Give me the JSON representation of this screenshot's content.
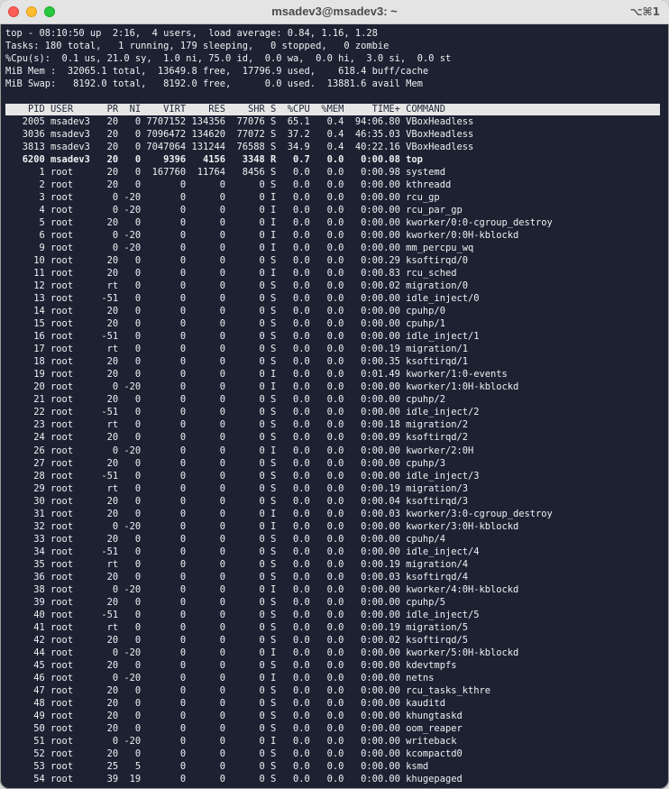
{
  "window": {
    "title": "msadev3@msadev3: ~",
    "shortcut": "⌥⌘1"
  },
  "summary": [
    "top - 08:10:50 up  2:16,  4 users,  load average: 0.84, 1.16, 1.28",
    "Tasks: 180 total,   1 running, 179 sleeping,   0 stopped,   0 zombie",
    "%Cpu(s):  0.1 us, 21.0 sy,  1.0 ni, 75.0 id,  0.0 wa,  0.0 hi,  3.0 si,  0.0 st",
    "MiB Mem :  32065.1 total,  13649.8 free,  17796.9 used,    618.4 buff/cache",
    "MiB Swap:   8192.0 total,   8192.0 free,      0.0 used.  13881.6 avail Mem"
  ],
  "columns": [
    "PID",
    "USER",
    "PR",
    "NI",
    "VIRT",
    "RES",
    "SHR",
    "S",
    "%CPU",
    "%MEM",
    "TIME+",
    "COMMAND"
  ],
  "processes": [
    {
      "pid": "2005",
      "user": "msadev3",
      "pr": "20",
      "ni": "0",
      "virt": "7707152",
      "res": "134356",
      "shr": "77076",
      "s": "S",
      "cpu": "65.1",
      "mem": "0.4",
      "time": "94:06.80",
      "cmd": "VBoxHeadless"
    },
    {
      "pid": "3036",
      "user": "msadev3",
      "pr": "20",
      "ni": "0",
      "virt": "7096472",
      "res": "134620",
      "shr": "77072",
      "s": "S",
      "cpu": "37.2",
      "mem": "0.4",
      "time": "46:35.03",
      "cmd": "VBoxHeadless"
    },
    {
      "pid": "3813",
      "user": "msadev3",
      "pr": "20",
      "ni": "0",
      "virt": "7047064",
      "res": "131244",
      "shr": "76588",
      "s": "S",
      "cpu": "34.9",
      "mem": "0.4",
      "time": "40:22.16",
      "cmd": "VBoxHeadless"
    },
    {
      "pid": "6200",
      "user": "msadev3",
      "pr": "20",
      "ni": "0",
      "virt": "9396",
      "res": "4156",
      "shr": "3348",
      "s": "R",
      "cpu": "0.7",
      "mem": "0.0",
      "time": "0:00.08",
      "cmd": "top",
      "bold": true
    },
    {
      "pid": "1",
      "user": "root",
      "pr": "20",
      "ni": "0",
      "virt": "167760",
      "res": "11764",
      "shr": "8456",
      "s": "S",
      "cpu": "0.0",
      "mem": "0.0",
      "time": "0:00.98",
      "cmd": "systemd"
    },
    {
      "pid": "2",
      "user": "root",
      "pr": "20",
      "ni": "0",
      "virt": "0",
      "res": "0",
      "shr": "0",
      "s": "S",
      "cpu": "0.0",
      "mem": "0.0",
      "time": "0:00.00",
      "cmd": "kthreadd"
    },
    {
      "pid": "3",
      "user": "root",
      "pr": "0",
      "ni": "-20",
      "virt": "0",
      "res": "0",
      "shr": "0",
      "s": "I",
      "cpu": "0.0",
      "mem": "0.0",
      "time": "0:00.00",
      "cmd": "rcu_gp"
    },
    {
      "pid": "4",
      "user": "root",
      "pr": "0",
      "ni": "-20",
      "virt": "0",
      "res": "0",
      "shr": "0",
      "s": "I",
      "cpu": "0.0",
      "mem": "0.0",
      "time": "0:00.00",
      "cmd": "rcu_par_gp"
    },
    {
      "pid": "5",
      "user": "root",
      "pr": "20",
      "ni": "0",
      "virt": "0",
      "res": "0",
      "shr": "0",
      "s": "I",
      "cpu": "0.0",
      "mem": "0.0",
      "time": "0:00.00",
      "cmd": "kworker/0:0-cgroup_destroy"
    },
    {
      "pid": "6",
      "user": "root",
      "pr": "0",
      "ni": "-20",
      "virt": "0",
      "res": "0",
      "shr": "0",
      "s": "I",
      "cpu": "0.0",
      "mem": "0.0",
      "time": "0:00.00",
      "cmd": "kworker/0:0H-kblockd"
    },
    {
      "pid": "9",
      "user": "root",
      "pr": "0",
      "ni": "-20",
      "virt": "0",
      "res": "0",
      "shr": "0",
      "s": "I",
      "cpu": "0.0",
      "mem": "0.0",
      "time": "0:00.00",
      "cmd": "mm_percpu_wq"
    },
    {
      "pid": "10",
      "user": "root",
      "pr": "20",
      "ni": "0",
      "virt": "0",
      "res": "0",
      "shr": "0",
      "s": "S",
      "cpu": "0.0",
      "mem": "0.0",
      "time": "0:00.29",
      "cmd": "ksoftirqd/0"
    },
    {
      "pid": "11",
      "user": "root",
      "pr": "20",
      "ni": "0",
      "virt": "0",
      "res": "0",
      "shr": "0",
      "s": "I",
      "cpu": "0.0",
      "mem": "0.0",
      "time": "0:00.83",
      "cmd": "rcu_sched"
    },
    {
      "pid": "12",
      "user": "root",
      "pr": "rt",
      "ni": "0",
      "virt": "0",
      "res": "0",
      "shr": "0",
      "s": "S",
      "cpu": "0.0",
      "mem": "0.0",
      "time": "0:00.02",
      "cmd": "migration/0"
    },
    {
      "pid": "13",
      "user": "root",
      "pr": "-51",
      "ni": "0",
      "virt": "0",
      "res": "0",
      "shr": "0",
      "s": "S",
      "cpu": "0.0",
      "mem": "0.0",
      "time": "0:00.00",
      "cmd": "idle_inject/0"
    },
    {
      "pid": "14",
      "user": "root",
      "pr": "20",
      "ni": "0",
      "virt": "0",
      "res": "0",
      "shr": "0",
      "s": "S",
      "cpu": "0.0",
      "mem": "0.0",
      "time": "0:00.00",
      "cmd": "cpuhp/0"
    },
    {
      "pid": "15",
      "user": "root",
      "pr": "20",
      "ni": "0",
      "virt": "0",
      "res": "0",
      "shr": "0",
      "s": "S",
      "cpu": "0.0",
      "mem": "0.0",
      "time": "0:00.00",
      "cmd": "cpuhp/1"
    },
    {
      "pid": "16",
      "user": "root",
      "pr": "-51",
      "ni": "0",
      "virt": "0",
      "res": "0",
      "shr": "0",
      "s": "S",
      "cpu": "0.0",
      "mem": "0.0",
      "time": "0:00.00",
      "cmd": "idle_inject/1"
    },
    {
      "pid": "17",
      "user": "root",
      "pr": "rt",
      "ni": "0",
      "virt": "0",
      "res": "0",
      "shr": "0",
      "s": "S",
      "cpu": "0.0",
      "mem": "0.0",
      "time": "0:00.19",
      "cmd": "migration/1"
    },
    {
      "pid": "18",
      "user": "root",
      "pr": "20",
      "ni": "0",
      "virt": "0",
      "res": "0",
      "shr": "0",
      "s": "S",
      "cpu": "0.0",
      "mem": "0.0",
      "time": "0:00.35",
      "cmd": "ksoftirqd/1"
    },
    {
      "pid": "19",
      "user": "root",
      "pr": "20",
      "ni": "0",
      "virt": "0",
      "res": "0",
      "shr": "0",
      "s": "I",
      "cpu": "0.0",
      "mem": "0.0",
      "time": "0:01.49",
      "cmd": "kworker/1:0-events"
    },
    {
      "pid": "20",
      "user": "root",
      "pr": "0",
      "ni": "-20",
      "virt": "0",
      "res": "0",
      "shr": "0",
      "s": "I",
      "cpu": "0.0",
      "mem": "0.0",
      "time": "0:00.00",
      "cmd": "kworker/1:0H-kblockd"
    },
    {
      "pid": "21",
      "user": "root",
      "pr": "20",
      "ni": "0",
      "virt": "0",
      "res": "0",
      "shr": "0",
      "s": "S",
      "cpu": "0.0",
      "mem": "0.0",
      "time": "0:00.00",
      "cmd": "cpuhp/2"
    },
    {
      "pid": "22",
      "user": "root",
      "pr": "-51",
      "ni": "0",
      "virt": "0",
      "res": "0",
      "shr": "0",
      "s": "S",
      "cpu": "0.0",
      "mem": "0.0",
      "time": "0:00.00",
      "cmd": "idle_inject/2"
    },
    {
      "pid": "23",
      "user": "root",
      "pr": "rt",
      "ni": "0",
      "virt": "0",
      "res": "0",
      "shr": "0",
      "s": "S",
      "cpu": "0.0",
      "mem": "0.0",
      "time": "0:00.18",
      "cmd": "migration/2"
    },
    {
      "pid": "24",
      "user": "root",
      "pr": "20",
      "ni": "0",
      "virt": "0",
      "res": "0",
      "shr": "0",
      "s": "S",
      "cpu": "0.0",
      "mem": "0.0",
      "time": "0:00.09",
      "cmd": "ksoftirqd/2"
    },
    {
      "pid": "26",
      "user": "root",
      "pr": "0",
      "ni": "-20",
      "virt": "0",
      "res": "0",
      "shr": "0",
      "s": "I",
      "cpu": "0.0",
      "mem": "0.0",
      "time": "0:00.00",
      "cmd": "kworker/2:0H"
    },
    {
      "pid": "27",
      "user": "root",
      "pr": "20",
      "ni": "0",
      "virt": "0",
      "res": "0",
      "shr": "0",
      "s": "S",
      "cpu": "0.0",
      "mem": "0.0",
      "time": "0:00.00",
      "cmd": "cpuhp/3"
    },
    {
      "pid": "28",
      "user": "root",
      "pr": "-51",
      "ni": "0",
      "virt": "0",
      "res": "0",
      "shr": "0",
      "s": "S",
      "cpu": "0.0",
      "mem": "0.0",
      "time": "0:00.00",
      "cmd": "idle_inject/3"
    },
    {
      "pid": "29",
      "user": "root",
      "pr": "rt",
      "ni": "0",
      "virt": "0",
      "res": "0",
      "shr": "0",
      "s": "S",
      "cpu": "0.0",
      "mem": "0.0",
      "time": "0:00.19",
      "cmd": "migration/3"
    },
    {
      "pid": "30",
      "user": "root",
      "pr": "20",
      "ni": "0",
      "virt": "0",
      "res": "0",
      "shr": "0",
      "s": "S",
      "cpu": "0.0",
      "mem": "0.0",
      "time": "0:00.04",
      "cmd": "ksoftirqd/3"
    },
    {
      "pid": "31",
      "user": "root",
      "pr": "20",
      "ni": "0",
      "virt": "0",
      "res": "0",
      "shr": "0",
      "s": "I",
      "cpu": "0.0",
      "mem": "0.0",
      "time": "0:00.03",
      "cmd": "kworker/3:0-cgroup_destroy"
    },
    {
      "pid": "32",
      "user": "root",
      "pr": "0",
      "ni": "-20",
      "virt": "0",
      "res": "0",
      "shr": "0",
      "s": "I",
      "cpu": "0.0",
      "mem": "0.0",
      "time": "0:00.00",
      "cmd": "kworker/3:0H-kblockd"
    },
    {
      "pid": "33",
      "user": "root",
      "pr": "20",
      "ni": "0",
      "virt": "0",
      "res": "0",
      "shr": "0",
      "s": "S",
      "cpu": "0.0",
      "mem": "0.0",
      "time": "0:00.00",
      "cmd": "cpuhp/4"
    },
    {
      "pid": "34",
      "user": "root",
      "pr": "-51",
      "ni": "0",
      "virt": "0",
      "res": "0",
      "shr": "0",
      "s": "S",
      "cpu": "0.0",
      "mem": "0.0",
      "time": "0:00.00",
      "cmd": "idle_inject/4"
    },
    {
      "pid": "35",
      "user": "root",
      "pr": "rt",
      "ni": "0",
      "virt": "0",
      "res": "0",
      "shr": "0",
      "s": "S",
      "cpu": "0.0",
      "mem": "0.0",
      "time": "0:00.19",
      "cmd": "migration/4"
    },
    {
      "pid": "36",
      "user": "root",
      "pr": "20",
      "ni": "0",
      "virt": "0",
      "res": "0",
      "shr": "0",
      "s": "S",
      "cpu": "0.0",
      "mem": "0.0",
      "time": "0:00.03",
      "cmd": "ksoftirqd/4"
    },
    {
      "pid": "38",
      "user": "root",
      "pr": "0",
      "ni": "-20",
      "virt": "0",
      "res": "0",
      "shr": "0",
      "s": "I",
      "cpu": "0.0",
      "mem": "0.0",
      "time": "0:00.00",
      "cmd": "kworker/4:0H-kblockd"
    },
    {
      "pid": "39",
      "user": "root",
      "pr": "20",
      "ni": "0",
      "virt": "0",
      "res": "0",
      "shr": "0",
      "s": "S",
      "cpu": "0.0",
      "mem": "0.0",
      "time": "0:00.00",
      "cmd": "cpuhp/5"
    },
    {
      "pid": "40",
      "user": "root",
      "pr": "-51",
      "ni": "0",
      "virt": "0",
      "res": "0",
      "shr": "0",
      "s": "S",
      "cpu": "0.0",
      "mem": "0.0",
      "time": "0:00.00",
      "cmd": "idle_inject/5"
    },
    {
      "pid": "41",
      "user": "root",
      "pr": "rt",
      "ni": "0",
      "virt": "0",
      "res": "0",
      "shr": "0",
      "s": "S",
      "cpu": "0.0",
      "mem": "0.0",
      "time": "0:00.19",
      "cmd": "migration/5"
    },
    {
      "pid": "42",
      "user": "root",
      "pr": "20",
      "ni": "0",
      "virt": "0",
      "res": "0",
      "shr": "0",
      "s": "S",
      "cpu": "0.0",
      "mem": "0.0",
      "time": "0:00.02",
      "cmd": "ksoftirqd/5"
    },
    {
      "pid": "44",
      "user": "root",
      "pr": "0",
      "ni": "-20",
      "virt": "0",
      "res": "0",
      "shr": "0",
      "s": "I",
      "cpu": "0.0",
      "mem": "0.0",
      "time": "0:00.00",
      "cmd": "kworker/5:0H-kblockd"
    },
    {
      "pid": "45",
      "user": "root",
      "pr": "20",
      "ni": "0",
      "virt": "0",
      "res": "0",
      "shr": "0",
      "s": "S",
      "cpu": "0.0",
      "mem": "0.0",
      "time": "0:00.00",
      "cmd": "kdevtmpfs"
    },
    {
      "pid": "46",
      "user": "root",
      "pr": "0",
      "ni": "-20",
      "virt": "0",
      "res": "0",
      "shr": "0",
      "s": "I",
      "cpu": "0.0",
      "mem": "0.0",
      "time": "0:00.00",
      "cmd": "netns"
    },
    {
      "pid": "47",
      "user": "root",
      "pr": "20",
      "ni": "0",
      "virt": "0",
      "res": "0",
      "shr": "0",
      "s": "S",
      "cpu": "0.0",
      "mem": "0.0",
      "time": "0:00.00",
      "cmd": "rcu_tasks_kthre"
    },
    {
      "pid": "48",
      "user": "root",
      "pr": "20",
      "ni": "0",
      "virt": "0",
      "res": "0",
      "shr": "0",
      "s": "S",
      "cpu": "0.0",
      "mem": "0.0",
      "time": "0:00.00",
      "cmd": "kauditd"
    },
    {
      "pid": "49",
      "user": "root",
      "pr": "20",
      "ni": "0",
      "virt": "0",
      "res": "0",
      "shr": "0",
      "s": "S",
      "cpu": "0.0",
      "mem": "0.0",
      "time": "0:00.00",
      "cmd": "khungtaskd"
    },
    {
      "pid": "50",
      "user": "root",
      "pr": "20",
      "ni": "0",
      "virt": "0",
      "res": "0",
      "shr": "0",
      "s": "S",
      "cpu": "0.0",
      "mem": "0.0",
      "time": "0:00.00",
      "cmd": "oom_reaper"
    },
    {
      "pid": "51",
      "user": "root",
      "pr": "0",
      "ni": "-20",
      "virt": "0",
      "res": "0",
      "shr": "0",
      "s": "I",
      "cpu": "0.0",
      "mem": "0.0",
      "time": "0:00.00",
      "cmd": "writeback"
    },
    {
      "pid": "52",
      "user": "root",
      "pr": "20",
      "ni": "0",
      "virt": "0",
      "res": "0",
      "shr": "0",
      "s": "S",
      "cpu": "0.0",
      "mem": "0.0",
      "time": "0:00.00",
      "cmd": "kcompactd0"
    },
    {
      "pid": "53",
      "user": "root",
      "pr": "25",
      "ni": "5",
      "virt": "0",
      "res": "0",
      "shr": "0",
      "s": "S",
      "cpu": "0.0",
      "mem": "0.0",
      "time": "0:00.00",
      "cmd": "ksmd"
    },
    {
      "pid": "54",
      "user": "root",
      "pr": "39",
      "ni": "19",
      "virt": "0",
      "res": "0",
      "shr": "0",
      "s": "S",
      "cpu": "0.0",
      "mem": "0.0",
      "time": "0:00.00",
      "cmd": "khugepaged"
    }
  ]
}
